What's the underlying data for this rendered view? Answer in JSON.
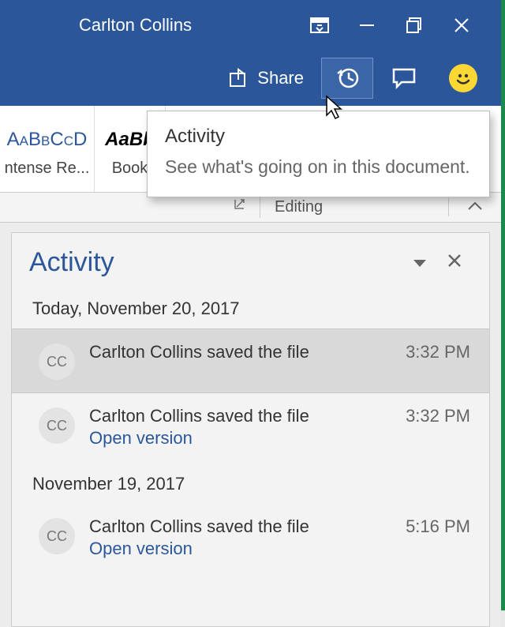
{
  "titlebar": {
    "username": "Carlton Collins"
  },
  "ribbon": {
    "share_label": "Share"
  },
  "styles": {
    "cell1_preview": "AaBbCcD",
    "cell1_label": "ntense Re...",
    "cell2_preview": "AaBb",
    "cell2_label": "Book "
  },
  "tooltip": {
    "title": "Activity",
    "body": "See what's going on in this document."
  },
  "status": {
    "editing_label": "Editing"
  },
  "pane": {
    "title": "Activity",
    "groups": [
      {
        "date": "Today, November 20, 2017",
        "items": [
          {
            "initials": "CC",
            "desc": "Carlton Collins saved the file",
            "time": "3:32 PM",
            "link": "",
            "selected": true
          },
          {
            "initials": "CC",
            "desc": "Carlton Collins saved the file",
            "time": "3:32 PM",
            "link": "Open version",
            "selected": false
          }
        ]
      },
      {
        "date": "November 19, 2017",
        "items": [
          {
            "initials": "CC",
            "desc": "Carlton Collins saved the file",
            "time": "5:16 PM",
            "link": "Open version",
            "selected": false
          }
        ]
      }
    ]
  }
}
